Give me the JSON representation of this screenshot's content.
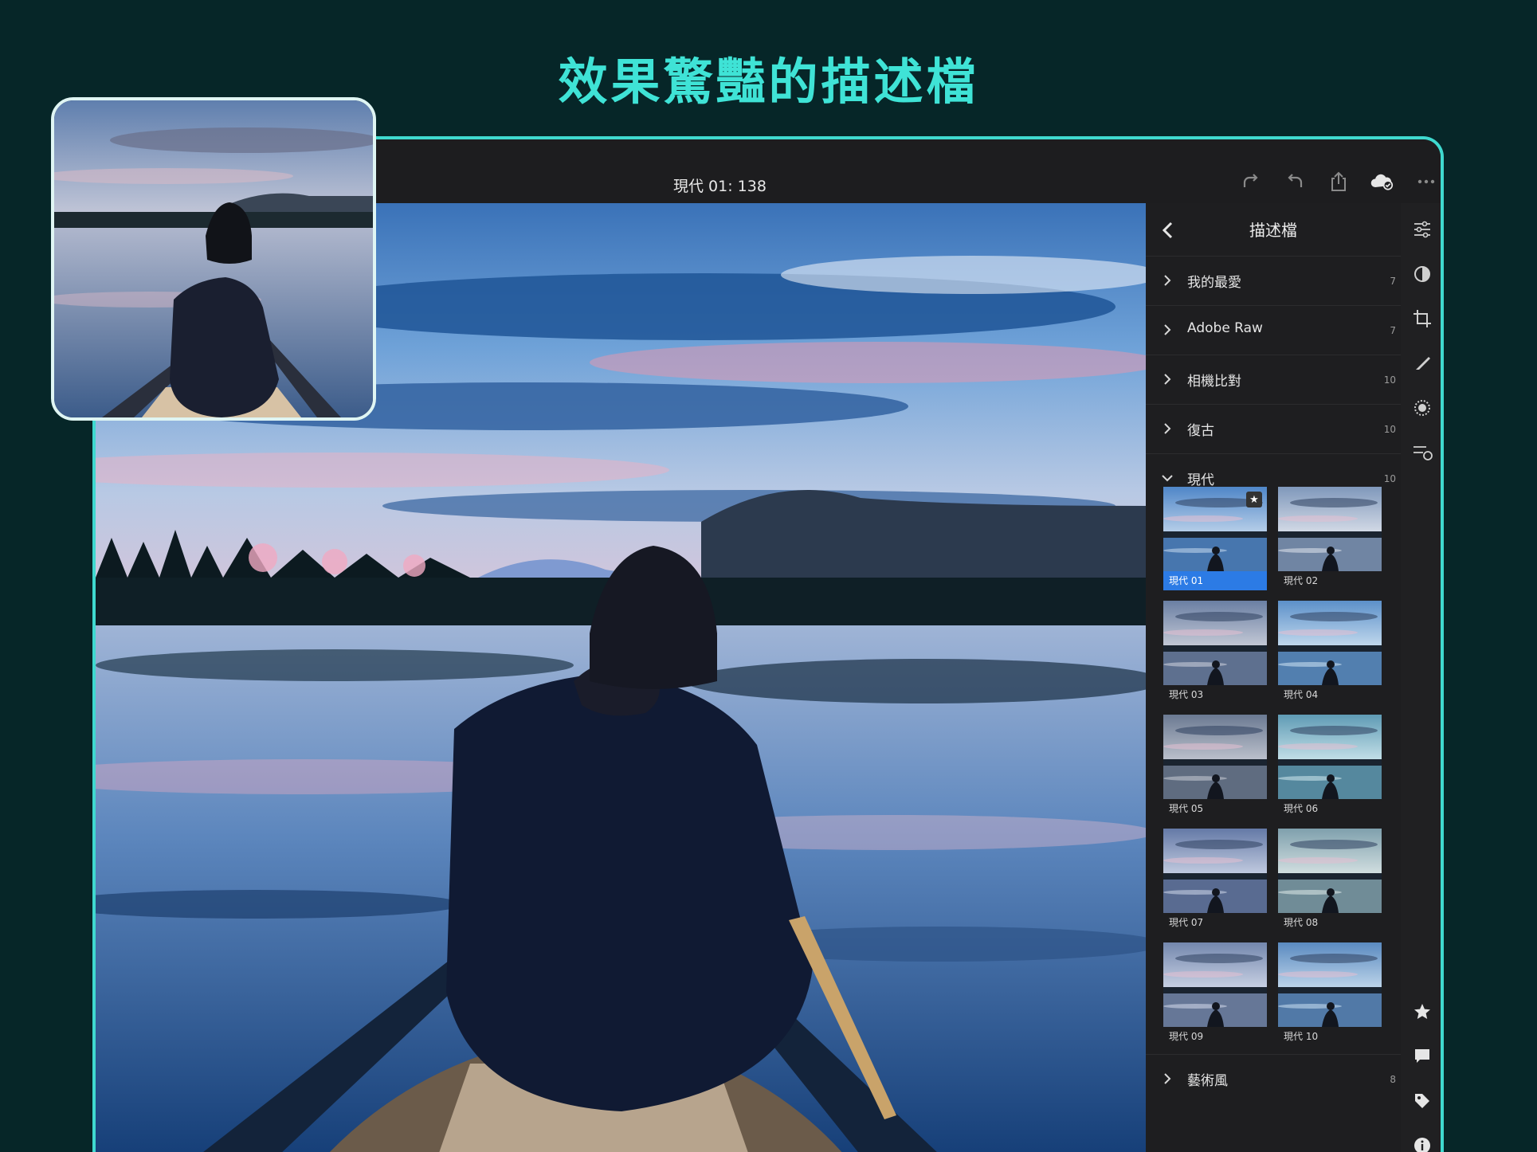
{
  "headline": "效果驚豔的描述檔",
  "document_title": "現代 01: 138",
  "toolbar_icons": [
    "redo-icon",
    "undo-icon",
    "share-icon",
    "cloud-sync-icon",
    "more-icon"
  ],
  "panel": {
    "title": "描述檔",
    "categories": [
      {
        "label": "我的最愛",
        "count": "7",
        "expanded": false
      },
      {
        "label": "Adobe Raw",
        "count": "7",
        "expanded": false
      },
      {
        "label": "相機比對",
        "count": "10",
        "expanded": false
      },
      {
        "label": "復古",
        "count": "10",
        "expanded": false
      },
      {
        "label": "現代",
        "count": "10",
        "expanded": true
      }
    ],
    "profiles": [
      "現代 01",
      "現代 02",
      "現代 03",
      "現代 04",
      "現代 05",
      "現代 06",
      "現代 07",
      "現代 08",
      "現代 09",
      "現代 10"
    ],
    "selected_profile": "現代 01",
    "after": {
      "label": "藝術風",
      "count": "8"
    }
  },
  "rail_icons_top": [
    "edit-sliders-icon",
    "profiles-icon",
    "crop-icon",
    "healing-icon",
    "masking-icon",
    "presets-icon"
  ],
  "rail_icons_bottom": [
    "star-icon",
    "comment-icon",
    "tag-icon",
    "info-icon"
  ],
  "colors": {
    "accent": "#3fe3d6",
    "selection": "#2c7be5",
    "background": "#062628"
  }
}
